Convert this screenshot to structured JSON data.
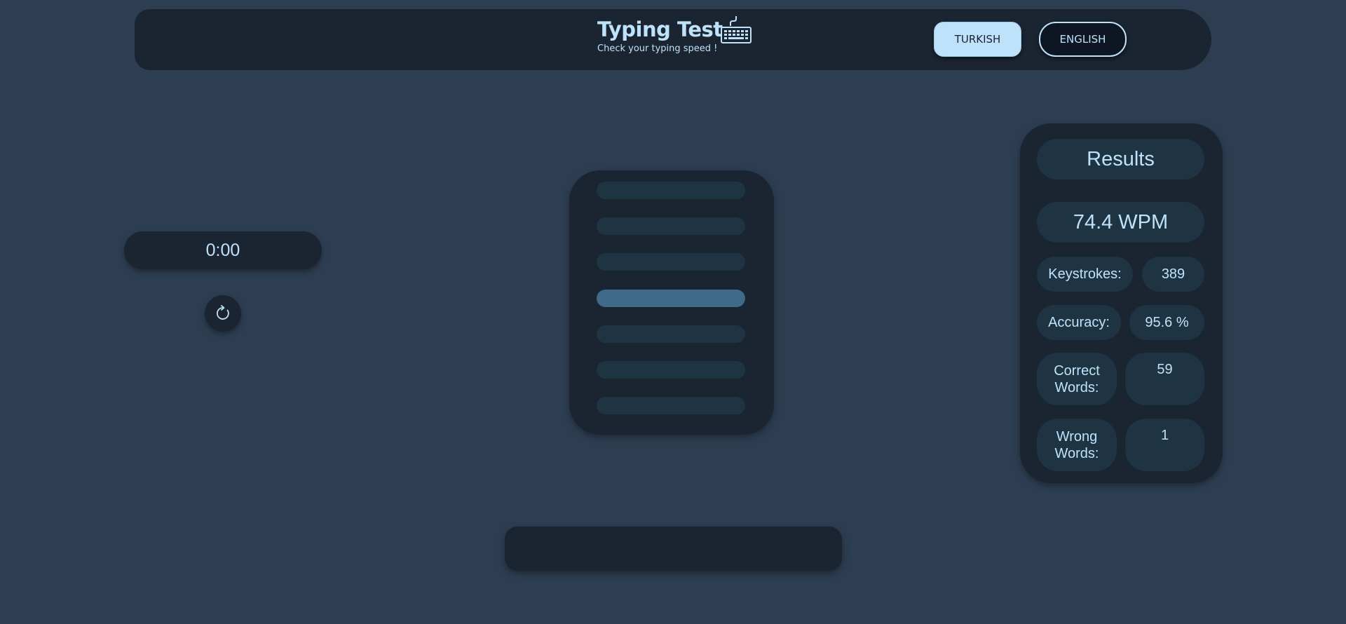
{
  "header": {
    "title": "Typing Test",
    "subtitle": "Check your typing speed !",
    "icon": "keyboard-icon",
    "languages": {
      "turkish": "TURKISH",
      "english": "ENGLISH"
    }
  },
  "timer": {
    "value": "0:00",
    "reset_icon": "refresh-icon"
  },
  "words": {
    "lines": [
      "",
      "",
      "",
      "",
      "",
      "",
      ""
    ],
    "active_index": 3
  },
  "input": {
    "value": "",
    "placeholder": ""
  },
  "results": {
    "title": "Results",
    "wpm": "74.4 WPM",
    "keystrokes_label": "Keystrokes:",
    "keystrokes_value": "389",
    "accuracy_label": "Accuracy:",
    "accuracy_value": "95.6 %",
    "correct_label_line1": "Correct",
    "correct_label_line2": "Words:",
    "correct_value": "59",
    "wrong_label_line1": "Wrong",
    "wrong_label_line2": "Words:",
    "wrong_value": "1"
  },
  "colors": {
    "background": "#2e3e52",
    "panel": "#1b2431",
    "pill": "#1f3442",
    "accent": "#bfe2fb",
    "active_line": "#3f6a8a"
  }
}
